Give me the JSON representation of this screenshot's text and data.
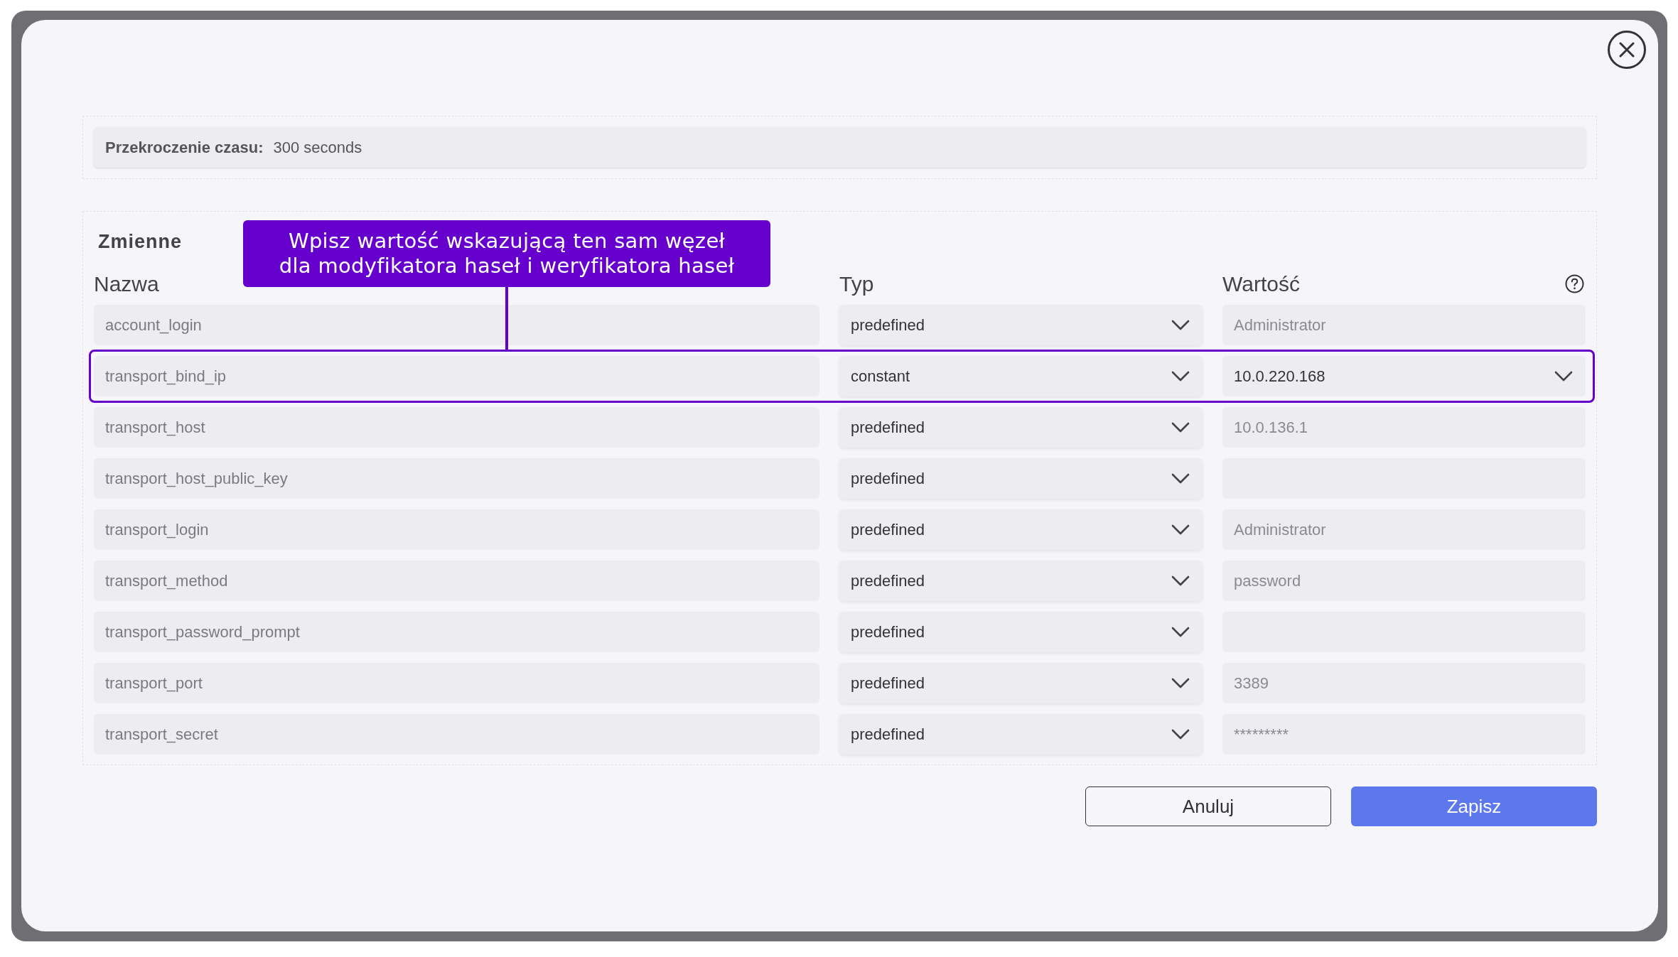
{
  "timeout": {
    "label": "Przekroczenie czasu:",
    "value": "300 seconds"
  },
  "variables": {
    "title": "Zmienne",
    "columns": [
      "Nazwa",
      "Typ",
      "Wartość"
    ],
    "rows": [
      {
        "name": "account_login",
        "type": "predefined",
        "value": {
          "kind": "readonly",
          "text": "Administrator"
        },
        "highlighted": false
      },
      {
        "name": "transport_bind_ip",
        "type": "constant",
        "value": {
          "kind": "select",
          "text": "10.0.220.168"
        },
        "highlighted": true
      },
      {
        "name": "transport_host",
        "type": "predefined",
        "value": {
          "kind": "readonly",
          "text": "10.0.136.1"
        },
        "highlighted": false
      },
      {
        "name": "transport_host_public_key",
        "type": "predefined",
        "value": {
          "kind": "readonly"
        },
        "highlighted": false
      },
      {
        "name": "transport_login",
        "type": "predefined",
        "value": {
          "kind": "readonly",
          "text": "Administrator"
        },
        "highlighted": false
      },
      {
        "name": "transport_method",
        "type": "predefined",
        "value": {
          "kind": "readonly",
          "text": "password"
        },
        "highlighted": false
      },
      {
        "name": "transport_password_prompt",
        "type": "predefined",
        "value": {
          "kind": "readonly"
        },
        "highlighted": false
      },
      {
        "name": "transport_port",
        "type": "predefined",
        "value": {
          "kind": "readonly",
          "text": "3389"
        },
        "highlighted": false
      },
      {
        "name": "transport_secret",
        "type": "predefined",
        "value": {
          "kind": "readonly",
          "text": "*********"
        },
        "highlighted": false
      }
    ]
  },
  "callout": {
    "text": "Wpisz wartość wskazującą ten sam węzeł\ndla modyfikatora haseł i weryfikatora haseł"
  },
  "buttons": [
    {
      "label": "Anuluj",
      "kind": "secondary"
    },
    {
      "label": "Zapisz",
      "kind": "primary"
    }
  ]
}
